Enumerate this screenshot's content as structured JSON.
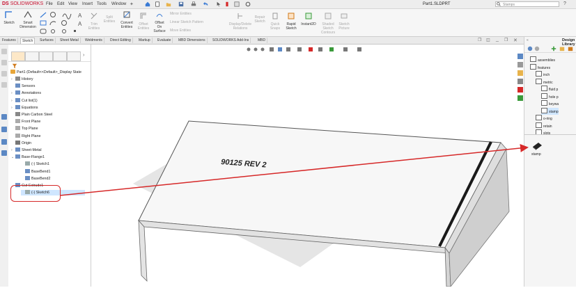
{
  "app": {
    "logo_prefix": "DS",
    "logo_text": "SOLIDWORKS",
    "doc_title": "Part1.SLDPRT",
    "search_placeholder": "Search Commands",
    "search_value": "Stamps"
  },
  "menu": [
    "File",
    "Edit",
    "View",
    "Insert",
    "Tools",
    "Window"
  ],
  "command_manager": {
    "sketch": "Sketch",
    "smart_dimension": [
      "Smart",
      "Dimension"
    ],
    "trim_entities": [
      "Trim",
      "Entities"
    ],
    "split_entities": [
      "Split",
      "Entities"
    ],
    "convert_entities": [
      "Convert",
      "Entities"
    ],
    "offset_entities": [
      "Offset",
      "Entities"
    ],
    "offset_on_surface": [
      "Offset",
      "On",
      "Surface"
    ],
    "mirror_entities": "Mirror Entities",
    "linear_sketch_pattern": "Linear Sketch Pattern",
    "move_entities": "Move Entities",
    "display_delete_relations": [
      "Display/Delete",
      "Relations"
    ],
    "repair_sketch": [
      "Repair",
      "Sketch"
    ],
    "quick_snaps": [
      "Quick",
      "Snaps"
    ],
    "rapid_sketch": [
      "Rapid",
      "Sketch"
    ],
    "instant2d": "Instant2D",
    "shaded_sketch_contours": [
      "Shaded",
      "Sketch",
      "Contours"
    ],
    "sketch_picture": [
      "Sketch",
      "Picture"
    ]
  },
  "tabs": [
    "Features",
    "Sketch",
    "Surfaces",
    "Sheet Metal",
    "Weldments",
    "Direct Editing",
    "Markup",
    "Evaluate",
    "MBD Dimensions",
    "SOLIDWORKS Add-Ins",
    "MBD"
  ],
  "active_tab": "Sketch",
  "tree": {
    "root": "Part1  (Default<<Default>_Display State",
    "items": [
      {
        "label": "History",
        "indent": 1,
        "caret": "›",
        "icon": "history-icon"
      },
      {
        "label": "Sensors",
        "indent": 1,
        "caret": "",
        "icon": "sensor-icon"
      },
      {
        "label": "Annotations",
        "indent": 1,
        "caret": "›",
        "icon": "annotation-icon"
      },
      {
        "label": "Cut list(1)",
        "indent": 1,
        "caret": "›",
        "icon": "cut-list-icon"
      },
      {
        "label": "Equations",
        "indent": 1,
        "caret": "›",
        "icon": "equation-icon"
      },
      {
        "label": "Plain Carbon Steel",
        "indent": 1,
        "caret": "",
        "icon": "material-icon"
      },
      {
        "label": "Front Plane",
        "indent": 1,
        "caret": "",
        "icon": "plane-icon"
      },
      {
        "label": "Top Plane",
        "indent": 1,
        "caret": "",
        "icon": "plane-icon"
      },
      {
        "label": "Right Plane",
        "indent": 1,
        "caret": "",
        "icon": "plane-icon"
      },
      {
        "label": "Origin",
        "indent": 1,
        "caret": "",
        "icon": "origin-icon"
      },
      {
        "label": "Sheet-Metal",
        "indent": 1,
        "caret": "›",
        "icon": "sheet-metal-icon"
      },
      {
        "label": "Base-Flange1",
        "indent": 1,
        "caret": "⌄",
        "icon": "base-flange-icon"
      },
      {
        "label": "(-) Sketch1",
        "indent": 2,
        "caret": "",
        "icon": "sketch-icon"
      },
      {
        "label": "BaseBend1",
        "indent": 2,
        "caret": "",
        "icon": "bend-icon"
      },
      {
        "label": "BaseBend2",
        "indent": 2,
        "caret": "",
        "icon": "bend-icon"
      },
      {
        "label": "Cut-Extrude1",
        "indent": 1,
        "caret": "⌄",
        "icon": "cut-extrude-icon"
      },
      {
        "label": "(-) Sketch6",
        "indent": 2,
        "caret": "",
        "icon": "sketch-icon"
      }
    ]
  },
  "model": {
    "engraved_text": "90125 REV 2"
  },
  "task_pane": {
    "title": "Design Library",
    "folders": [
      {
        "label": "assemblies",
        "indent": 0
      },
      {
        "label": "features",
        "indent": 0
      },
      {
        "label": "inch",
        "indent": 1
      },
      {
        "label": "metric",
        "indent": 1
      },
      {
        "label": "fluid p",
        "indent": 2
      },
      {
        "label": "hole p",
        "indent": 2
      },
      {
        "label": "keywa",
        "indent": 2
      },
      {
        "label": "stamp",
        "indent": 2,
        "selected": true
      },
      {
        "label": "o-ring",
        "indent": 1
      },
      {
        "label": "retain",
        "indent": 1
      },
      {
        "label": "slots",
        "indent": 1
      }
    ],
    "item_label": "stamp"
  },
  "colors": {
    "accent_red": "#d62828",
    "selection_blue": "#cfe6ff",
    "solidworks_red": "#c8102e"
  }
}
